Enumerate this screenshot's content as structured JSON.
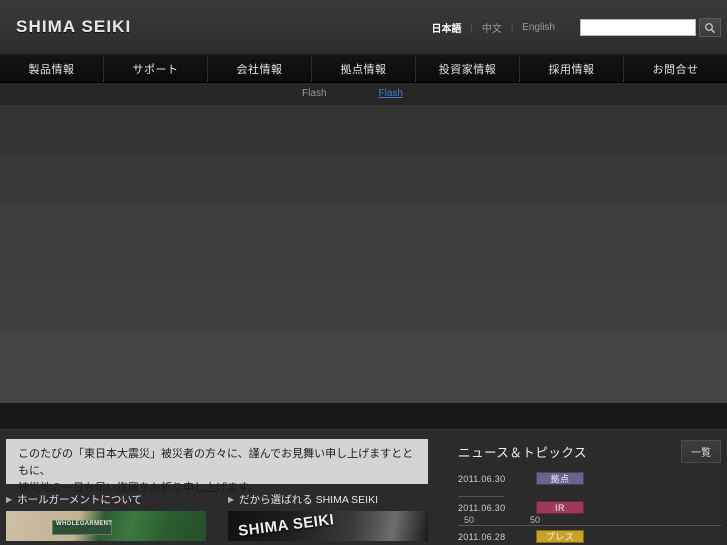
{
  "header": {
    "logo": "SHIMA SEIKI",
    "languages": [
      {
        "label": "日本語",
        "active": true
      },
      {
        "label": "中文",
        "active": false
      },
      {
        "label": "English",
        "active": false
      }
    ],
    "search": {
      "value": "",
      "placeholder": "",
      "icon": "search-icon"
    }
  },
  "gnav": [
    {
      "label": "製品情報"
    },
    {
      "label": "サポート"
    },
    {
      "label": "会社情報"
    },
    {
      "label": "拠点情報"
    },
    {
      "label": "投資家情報"
    },
    {
      "label": "採用情報"
    },
    {
      "label": "お問合せ"
    }
  ],
  "hero": {
    "flash_label": "Flash",
    "flash_link": "Flash"
  },
  "notice": {
    "line1": "このたびの「東日本大震災」被災者の方々に、謹んでお見舞い申し上げますとともに、",
    "line2": "被災地の一日も早い復興をお祈り申し上げます。"
  },
  "promos": [
    {
      "title": "ホールガーメントについて",
      "image_caption": "WHOLEGARMENT"
    },
    {
      "title": "だから選ばれる SHIMA SEIKI",
      "image_caption": "SHIMA SEIKI"
    }
  ],
  "news": {
    "title": "ニュース＆トピックス",
    "all_button": "一覧",
    "items": [
      {
        "date": "2011.06.30",
        "badge": "拠点",
        "badge_color": "#6b6490",
        "text": "",
        "text2": ""
      },
      {
        "date": "2011.06.30",
        "badge": "IR",
        "badge_color": "#9c3a5e",
        "text": "50",
        "text2": "50"
      },
      {
        "date": "2011.06.28",
        "badge": "プレス",
        "badge_color": "#c9a227",
        "text": "",
        "text2": ""
      }
    ]
  }
}
